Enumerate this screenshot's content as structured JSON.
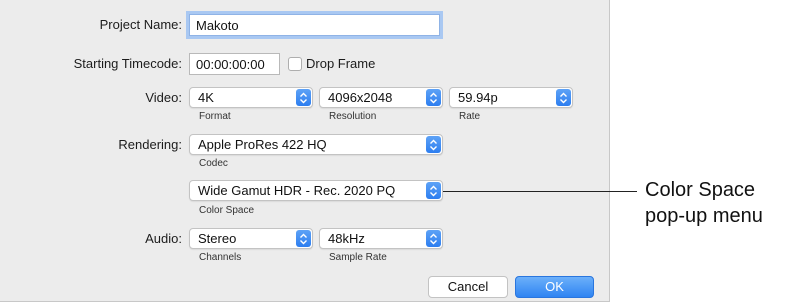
{
  "project_name": {
    "label": "Project Name:",
    "value": "Makoto"
  },
  "timecode": {
    "label": "Starting Timecode:",
    "value": "00:00:00:00",
    "drop_frame_label": "Drop Frame",
    "drop_frame_checked": false
  },
  "video": {
    "label": "Video:",
    "format": {
      "value": "4K",
      "caption": "Format"
    },
    "resolution": {
      "value": "4096x2048",
      "caption": "Resolution"
    },
    "rate": {
      "value": "59.94p",
      "caption": "Rate"
    }
  },
  "rendering": {
    "label": "Rendering:",
    "codec": {
      "value": "Apple ProRes 422 HQ",
      "caption": "Codec"
    },
    "color_space": {
      "value": "Wide Gamut HDR - Rec. 2020 PQ",
      "caption": "Color Space"
    }
  },
  "audio": {
    "label": "Audio:",
    "channels": {
      "value": "Stereo",
      "caption": "Channels"
    },
    "sample_rate": {
      "value": "48kHz",
      "caption": "Sample Rate"
    }
  },
  "buttons": {
    "cancel": "Cancel",
    "ok": "OK"
  },
  "callout": {
    "line1": "Color Space",
    "line2": "pop-up menu"
  },
  "colors": {
    "accent": "#2f84f2",
    "panel_bg": "#ececec"
  }
}
